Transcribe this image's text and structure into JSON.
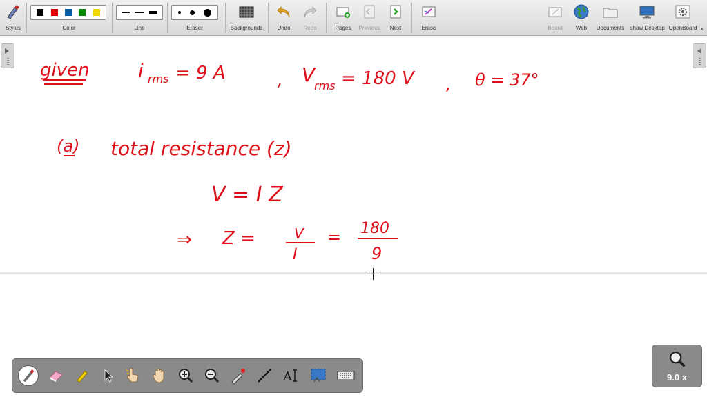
{
  "toolbar": {
    "stylus": "Stylus",
    "color": "Color",
    "line": "Line",
    "eraser": "Eraser",
    "backgrounds": "Backgrounds",
    "undo": "Undo",
    "redo": "Redo",
    "pages": "Pages",
    "previous": "Previous",
    "next": "Next",
    "erase": "Erase",
    "board": "Board",
    "web": "Web",
    "documents": "Documents",
    "show_desktop": "Show Desktop",
    "openboard": "OpenBoard"
  },
  "colors": {
    "palette": [
      "#000000",
      "#e00000",
      "#005ea8",
      "#008a00",
      "#f2d600"
    ],
    "ink": "#e0101a"
  },
  "handwriting": {
    "given": "given",
    "irms": "i",
    "rms_sub": "rms",
    "irms_value": "= 9 A",
    "comma1": ",",
    "vrms": "V",
    "vrms_value": "= 180 V",
    "comma2": ",",
    "theta": "θ = 37°",
    "part_a": "(a)",
    "total_resistance": "total resistance (z)",
    "eq1": "V = I Z",
    "implies": "⇒",
    "z_eq": "Z =",
    "frac_v_num": "V",
    "frac_v_den": "I",
    "eq_sign": "=",
    "frac_num": "180",
    "frac_den": "9"
  },
  "zoom": {
    "label": "9.0 x"
  }
}
